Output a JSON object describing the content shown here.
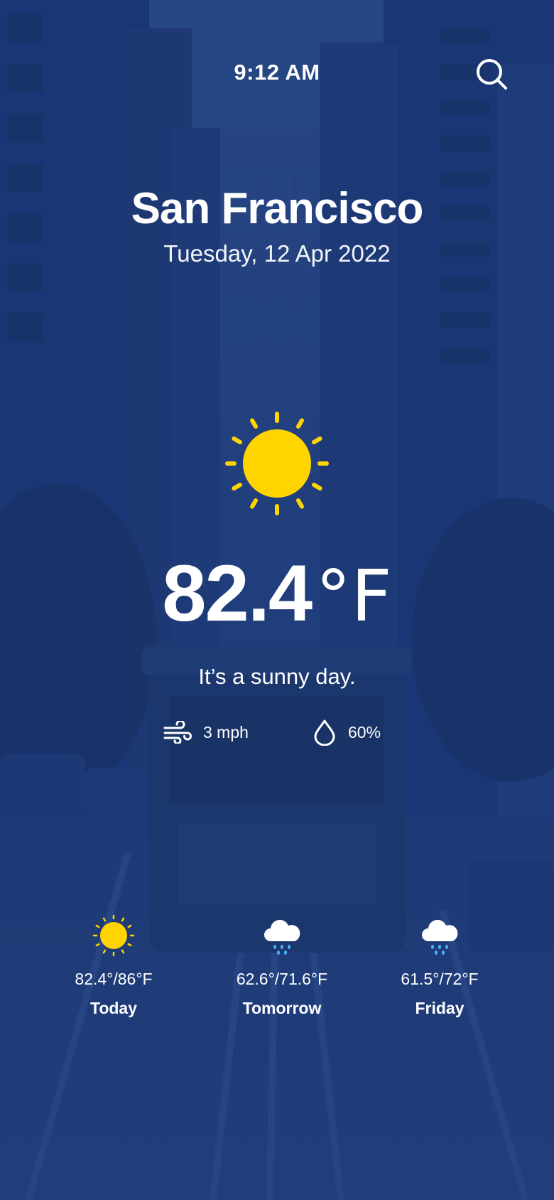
{
  "status": {
    "time": "9:12 AM"
  },
  "header": {
    "search_icon": "search-icon"
  },
  "location": {
    "city": "San Francisco",
    "date": "Tuesday, 12 Apr 2022"
  },
  "current": {
    "icon": "sun-icon",
    "temperature": "82.4",
    "unit": "°F",
    "condition": "It’s a sunny day.",
    "wind": "3 mph",
    "humidity": "60%"
  },
  "forecast": [
    {
      "label": "Today",
      "range": "82.4°/86°F",
      "icon": "sun-icon"
    },
    {
      "label": "Tomorrow",
      "range": "62.6°/71.6°F",
      "icon": "rain-cloud-icon"
    },
    {
      "label": "Friday",
      "range": "61.5°/72°F",
      "icon": "rain-cloud-icon"
    }
  ],
  "colors": {
    "background": "#1e3a72",
    "sun": "#ffd400",
    "cloud": "#ffffff",
    "raindrop": "#4fb3ff"
  }
}
